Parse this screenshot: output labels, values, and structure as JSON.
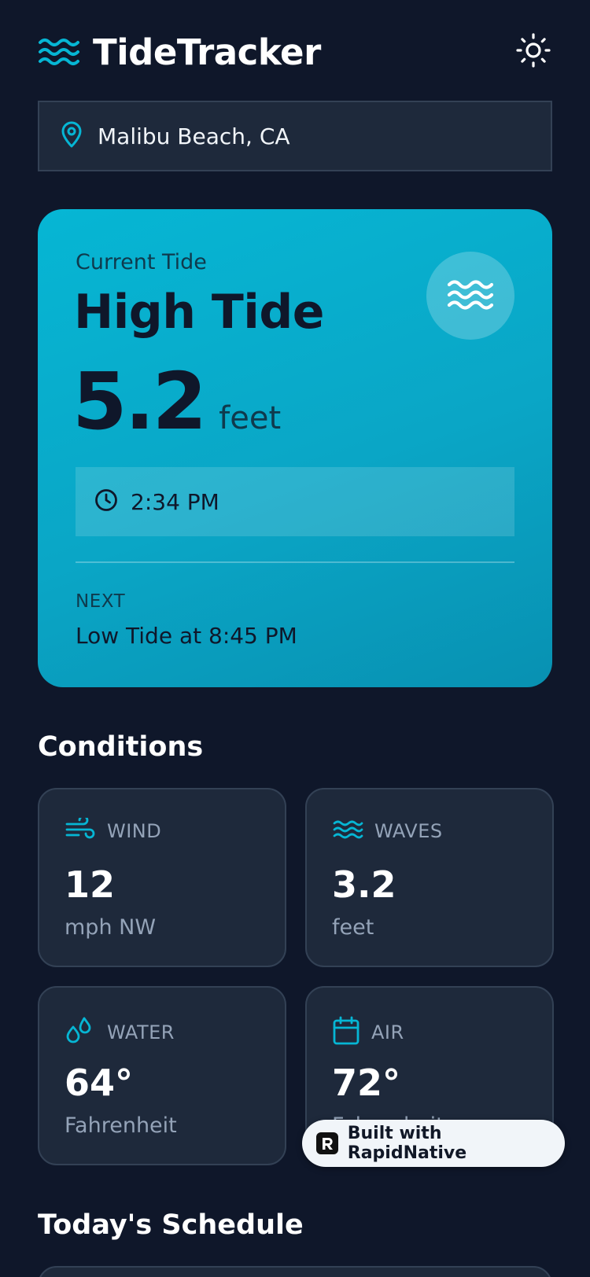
{
  "header": {
    "title": "TideTracker",
    "logo_icon": "waves-icon",
    "theme_icon": "sun-icon"
  },
  "location": {
    "icon": "map-pin-icon",
    "value": "Malibu Beach, CA"
  },
  "current_tide": {
    "label": "Current Tide",
    "status": "High Tide",
    "height": "5.2",
    "unit": "feet",
    "time": "2:34 PM",
    "next_label": "NEXT",
    "next_text": "Low Tide at 8:45 PM"
  },
  "conditions": {
    "title": "Conditions",
    "items": [
      {
        "icon": "wind-icon",
        "label": "WIND",
        "value": "12",
        "unit": "mph NW"
      },
      {
        "icon": "waves-icon",
        "label": "WAVES",
        "value": "3.2",
        "unit": "feet"
      },
      {
        "icon": "droplets-icon",
        "label": "WATER",
        "value": "64°",
        "unit": "Fahrenheit"
      },
      {
        "icon": "calendar-icon",
        "label": "AIR",
        "value": "72°",
        "unit": "Fahrenheit"
      }
    ]
  },
  "schedule": {
    "title": "Today's Schedule"
  },
  "badge": {
    "text": "Built with RapidNative"
  },
  "colors": {
    "background": "#0f172a",
    "card": "#1e293b",
    "accent": "#06b6d4",
    "muted": "#94a3b8"
  }
}
